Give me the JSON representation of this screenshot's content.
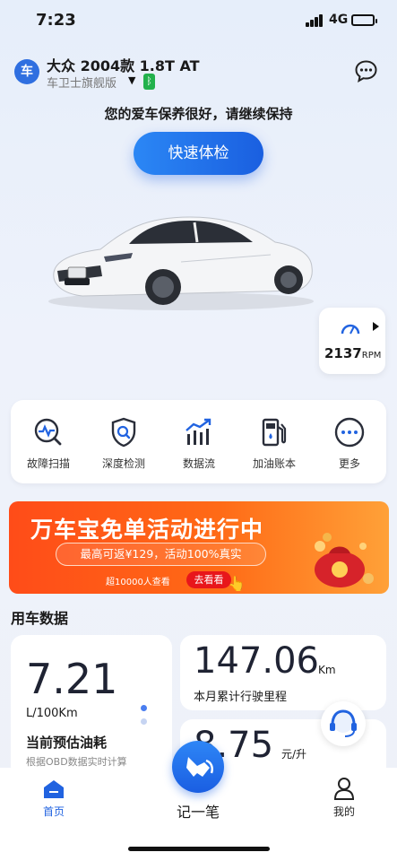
{
  "status_bar": {
    "time": "7:23",
    "network": "4G"
  },
  "header": {
    "brand_badge": "车",
    "car_title": "大众 2004款 1.8T AT",
    "car_subtitle": "车卫士旗舰版",
    "bluetooth_icon": "bluetooth-icon",
    "message_icon": "chat-bubble-icon"
  },
  "health": {
    "message": "您的爱车保养很好，请继续保持",
    "check_button": "快速体检"
  },
  "rpm": {
    "value": "2137",
    "unit": "RPM"
  },
  "tools": [
    {
      "label": "故障扫描",
      "icon": "scan-icon"
    },
    {
      "label": "深度检测",
      "icon": "shield-search-icon"
    },
    {
      "label": "数据流",
      "icon": "chart-trend-icon"
    },
    {
      "label": "加油账本",
      "icon": "fuel-pump-icon"
    },
    {
      "label": "更多",
      "icon": "more-icon"
    }
  ],
  "banner": {
    "title": "万车宝免单活动进行中",
    "pill": "最高可返¥129，活动100%真实",
    "count": "超10000人查看",
    "cta": "去看看"
  },
  "usage": {
    "section_title": "用车数据",
    "fuel": {
      "value": "7.21",
      "unit": "L/100Km",
      "label": "当前预估油耗",
      "hint": "根据OBD数据实时计算"
    },
    "mileage": {
      "value": "147.06",
      "unit": "Km",
      "label": "本月累计行驶里程"
    },
    "price": {
      "value": "8.75",
      "unit": "元/升"
    }
  },
  "tabbar": {
    "home": "首页",
    "record": "记一笔",
    "mine": "我的"
  },
  "colors": {
    "accent": "#2163e0",
    "banner": "#ff5a1a",
    "active_dot": "#4a7ef0"
  }
}
